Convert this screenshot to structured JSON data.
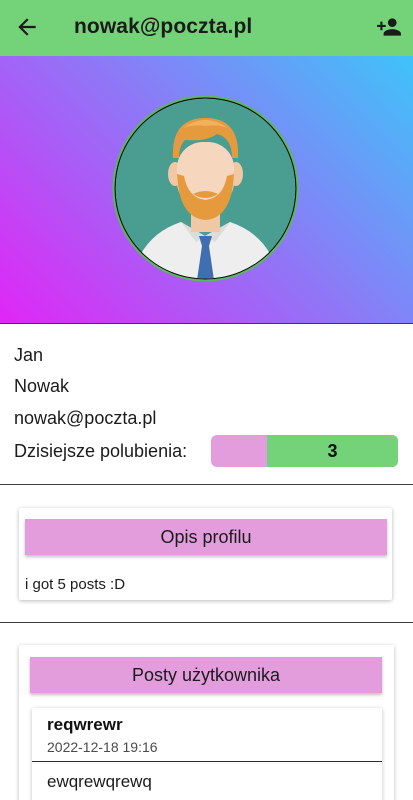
{
  "appbar": {
    "title": "nowak@poczta.pl",
    "back_icon": "arrow-left-icon",
    "add_icon": "person-add-icon",
    "background": "#74d279"
  },
  "hero": {
    "gradient_colors": [
      "#3fc3f9",
      "#8a7cf7",
      "#e126f6"
    ],
    "avatar_icon": "bearded-man-avatar"
  },
  "profile": {
    "first_name": "Jan",
    "last_name": "Nowak",
    "email": "nowak@poczta.pl",
    "likes_label": "Dzisiejsze polubienia:",
    "likes_value": "3",
    "likes_fill_fraction": 0.7
  },
  "bio": {
    "header": "Opis profilu",
    "text": "i got 5 posts :D",
    "header_color": "#e39ddd"
  },
  "posts": {
    "header": "Posty użytkownika",
    "items": [
      {
        "title": "reqwrewr",
        "date": "2022-12-18 19:16",
        "body": "ewqrewqrewq"
      }
    ]
  }
}
